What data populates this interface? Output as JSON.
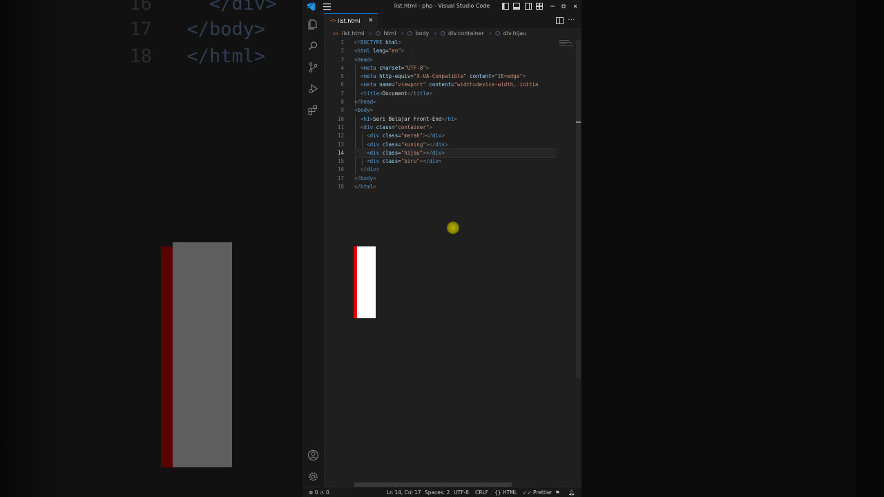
{
  "window": {
    "title": "list.html - php - Visual Studio Code"
  },
  "tab": {
    "label": "list.html",
    "icon": "<>"
  },
  "breadcrumb": [
    "list.html",
    "html",
    "body",
    "div.container",
    "div.hijau"
  ],
  "code": {
    "active_line": 14,
    "lines": [
      [
        [
          "br",
          "<!"
        ],
        [
          "tag",
          "DOCTYPE"
        ],
        [
          "txt",
          " "
        ],
        [
          "attr",
          "html"
        ],
        [
          "br",
          ">"
        ]
      ],
      [
        [
          "br",
          "<"
        ],
        [
          "tag",
          "html"
        ],
        [
          "txt",
          " "
        ],
        [
          "attr",
          "lang"
        ],
        [
          "txt",
          "="
        ],
        [
          "str",
          "\"en\""
        ],
        [
          "br",
          ">"
        ]
      ],
      [
        [
          "br",
          "<"
        ],
        [
          "tag",
          "head"
        ],
        [
          "br",
          ">"
        ]
      ],
      [
        [
          "txt",
          "  "
        ],
        [
          "br",
          "<"
        ],
        [
          "tag",
          "meta"
        ],
        [
          "txt",
          " "
        ],
        [
          "attr",
          "charset"
        ],
        [
          "txt",
          "="
        ],
        [
          "str",
          "\"UTF-8\""
        ],
        [
          "br",
          ">"
        ]
      ],
      [
        [
          "txt",
          "  "
        ],
        [
          "br",
          "<"
        ],
        [
          "tag",
          "meta"
        ],
        [
          "txt",
          " "
        ],
        [
          "attr",
          "http-equiv"
        ],
        [
          "txt",
          "="
        ],
        [
          "str",
          "\"X-UA-Compatible\""
        ],
        [
          "txt",
          " "
        ],
        [
          "attr",
          "content"
        ],
        [
          "txt",
          "="
        ],
        [
          "str",
          "\"IE=edge\""
        ],
        [
          "br",
          ">"
        ]
      ],
      [
        [
          "txt",
          "  "
        ],
        [
          "br",
          "<"
        ],
        [
          "tag",
          "meta"
        ],
        [
          "txt",
          " "
        ],
        [
          "attr",
          "name"
        ],
        [
          "txt",
          "="
        ],
        [
          "str",
          "\"viewport\""
        ],
        [
          "txt",
          " "
        ],
        [
          "attr",
          "content"
        ],
        [
          "txt",
          "="
        ],
        [
          "str",
          "\"width=device-width, initia"
        ]
      ],
      [
        [
          "txt",
          "  "
        ],
        [
          "br",
          "<"
        ],
        [
          "tag",
          "title"
        ],
        [
          "br",
          ">"
        ],
        [
          "txt",
          "Document"
        ],
        [
          "br",
          "</"
        ],
        [
          "tag",
          "title"
        ],
        [
          "br",
          ">"
        ]
      ],
      [
        [
          "br",
          "</"
        ],
        [
          "tag",
          "head"
        ],
        [
          "br",
          ">"
        ]
      ],
      [
        [
          "br",
          "<"
        ],
        [
          "tag",
          "body"
        ],
        [
          "br",
          ">"
        ]
      ],
      [
        [
          "txt",
          "  "
        ],
        [
          "br",
          "<"
        ],
        [
          "tag",
          "h1"
        ],
        [
          "br",
          ">"
        ],
        [
          "txt",
          "Seri Belajar Front-End"
        ],
        [
          "br",
          "</"
        ],
        [
          "tag",
          "h1"
        ],
        [
          "br",
          ">"
        ]
      ],
      [
        [
          "txt",
          "  "
        ],
        [
          "br",
          "<"
        ],
        [
          "tag",
          "div"
        ],
        [
          "txt",
          " "
        ],
        [
          "attr",
          "class"
        ],
        [
          "txt",
          "="
        ],
        [
          "str",
          "\"container\""
        ],
        [
          "br",
          ">"
        ]
      ],
      [
        [
          "txt",
          "    "
        ],
        [
          "br",
          "<"
        ],
        [
          "tag",
          "div"
        ],
        [
          "txt",
          " "
        ],
        [
          "attr",
          "class"
        ],
        [
          "txt",
          "="
        ],
        [
          "str",
          "\"merah\""
        ],
        [
          "br",
          "></"
        ],
        [
          "tag",
          "div"
        ],
        [
          "br",
          ">"
        ]
      ],
      [
        [
          "txt",
          "    "
        ],
        [
          "br",
          "<"
        ],
        [
          "tag",
          "div"
        ],
        [
          "txt",
          " "
        ],
        [
          "attr",
          "class"
        ],
        [
          "txt",
          "="
        ],
        [
          "str",
          "\"kuning\""
        ],
        [
          "br",
          "></"
        ],
        [
          "tag",
          "div"
        ],
        [
          "br",
          ">"
        ]
      ],
      [
        [
          "txt",
          "    "
        ],
        [
          "br",
          "<"
        ],
        [
          "tag",
          "div"
        ],
        [
          "txt",
          " "
        ],
        [
          "attr",
          "class"
        ],
        [
          "txt",
          "="
        ],
        [
          "str",
          "\"hijau\""
        ],
        [
          "br",
          "></"
        ],
        [
          "tag",
          "div"
        ],
        [
          "br",
          ">"
        ]
      ],
      [
        [
          "txt",
          "    "
        ],
        [
          "br",
          "<"
        ],
        [
          "tag",
          "div"
        ],
        [
          "txt",
          " "
        ],
        [
          "attr",
          "class"
        ],
        [
          "txt",
          "="
        ],
        [
          "str",
          "\"biru\""
        ],
        [
          "br",
          "></"
        ],
        [
          "tag",
          "div"
        ],
        [
          "br",
          ">"
        ]
      ],
      [
        [
          "txt",
          "  "
        ],
        [
          "br",
          "</"
        ],
        [
          "tag",
          "div"
        ],
        [
          "br",
          ">"
        ]
      ],
      [
        [
          "br",
          "</"
        ],
        [
          "tag",
          "body"
        ],
        [
          "br",
          ">"
        ]
      ],
      [
        [
          "br",
          "</"
        ],
        [
          "tag",
          "html"
        ],
        [
          "br",
          ">"
        ]
      ]
    ]
  },
  "background_code": [
    {
      "num": "16",
      "text": "    </div>"
    },
    {
      "num": "17",
      "text": "  </body>"
    },
    {
      "num": "18",
      "text": "  </html>"
    }
  ],
  "status": {
    "problems": "0",
    "warnings": "0",
    "position": "Ln 14, Col 17",
    "spaces": "Spaces: 2",
    "encoding": "UTF-8",
    "eol": "CRLF",
    "language": "HTML",
    "formatter": "Prettier"
  },
  "colors": {
    "accent": "#0078d4",
    "preview_red": "#e60000",
    "preview_white": "#ffffff"
  }
}
